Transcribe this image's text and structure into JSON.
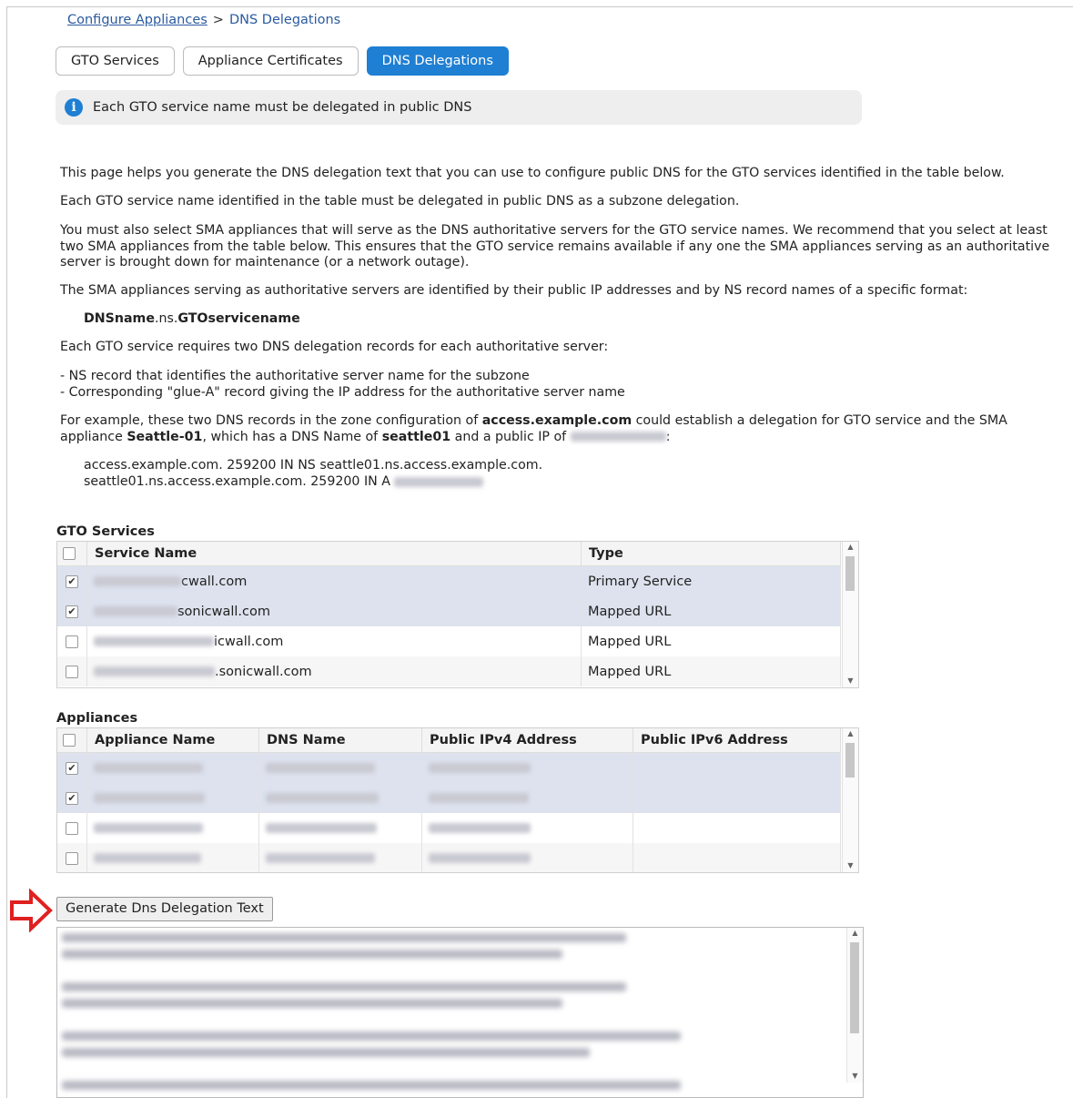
{
  "breadcrumb": {
    "link": "Configure Appliances",
    "separator": ">",
    "current": "DNS Delegations"
  },
  "tabs": [
    {
      "label": "GTO Services",
      "active": false
    },
    {
      "label": "Appliance Certificates",
      "active": false
    },
    {
      "label": "DNS Delegations",
      "active": true
    }
  ],
  "info": {
    "icon": "info-icon",
    "text": "Each GTO service name must be delegated in public DNS"
  },
  "body": {
    "p1": "This page helps you generate the DNS delegation text that you can use to configure public DNS for the GTO services identified in the table below.",
    "p2": "Each GTO service name identified in the table must be delegated in public DNS as a subzone delegation.",
    "p3_l1": "You must also select SMA appliances that will serve as the DNS authoritative servers for the GTO service names. We recommend that you select at least",
    "p3_l2": "two SMA appliances from the table below. This ensures that the GTO service remains available if any one the SMA appliances serving as an authoritative",
    "p3_l3": "server is brought down for maintenance (or a network outage).",
    "p4": "The SMA appliances serving as authoritative servers are identified by their public IP addresses and by NS record names of a specific format:",
    "fmt_a": "DNSname",
    "fmt_b": ".ns.",
    "fmt_c": "GTOservicename",
    "p5": "Each GTO service requires two DNS delegation records for each authoritative server:",
    "bullet1": "- NS record that identifies the authoritative server name for the subzone",
    "bullet2": "- Corresponding \"glue-A\" record giving the IP address for the authoritative server name",
    "ex_a": "For example, these two DNS records in the zone configuration of ",
    "ex_b": "access.example.com",
    "ex_c": " could establish a delegation for GTO service and the SMA",
    "ex2_a": "appliance ",
    "ex2_b": "Seattle-01",
    "ex2_c": ", which has a DNS Name of ",
    "ex2_d": "seattle01",
    "ex2_e": " and a public IP of ",
    "ex2_f": ":",
    "rec1": "access.example.com. 259200 IN NS seattle01.ns.access.example.com.",
    "rec2": "seattle01.ns.access.example.com. 259200 IN A "
  },
  "gto_services": {
    "title": "GTO Services",
    "columns": [
      "Service Name",
      "Type"
    ],
    "rows": [
      {
        "checked": true,
        "name_suffix": "cwall.com",
        "type": "Primary Service"
      },
      {
        "checked": true,
        "name_suffix": "sonicwall.com",
        "type": "Mapped URL"
      },
      {
        "checked": false,
        "name_suffix": "icwall.com",
        "type": "Mapped URL"
      },
      {
        "checked": false,
        "name_suffix": ".sonicwall.com",
        "type": "Mapped URL"
      }
    ]
  },
  "appliances": {
    "title": "Appliances",
    "columns": [
      "Appliance Name",
      "DNS Name",
      "Public IPv4 Address",
      "Public IPv6 Address"
    ],
    "rows": [
      {
        "checked": true
      },
      {
        "checked": true
      },
      {
        "checked": false
      },
      {
        "checked": false
      }
    ]
  },
  "generate_button": "Generate Dns Delegation Text",
  "colors": {
    "accent": "#1e7fd3",
    "selected_row": "#dde2ee",
    "arrow": "#e02020"
  }
}
